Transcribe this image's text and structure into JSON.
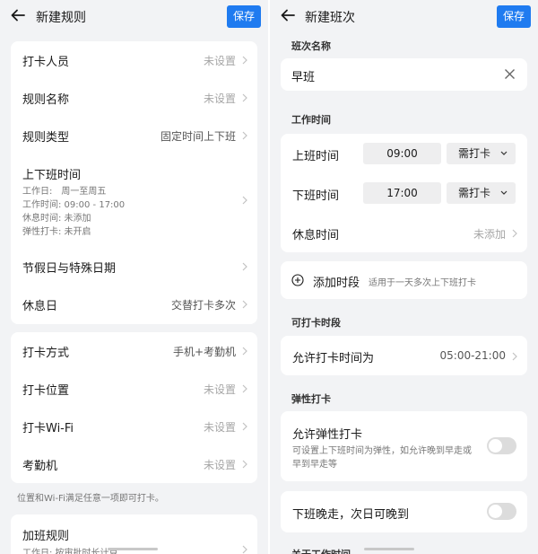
{
  "left": {
    "header": {
      "title": "新建规则",
      "save_label": "保存"
    },
    "card1": {
      "rows": [
        {
          "label": "打卡人员",
          "value": "未设置"
        },
        {
          "label": "规则名称",
          "value": "未设置"
        },
        {
          "label": "规则类型",
          "value": "固定时间上下班"
        }
      ],
      "schedule": {
        "title": "上下班时间",
        "lines": [
          "工作日:　周一至周五",
          "工作时间:  09:00 - 17:00",
          "休息时间:  未添加",
          "弹性打卡:  未开启"
        ]
      },
      "rows2": [
        {
          "label": "节假日与特殊日期",
          "value": ""
        },
        {
          "label": "休息日",
          "value": "交替打卡多次"
        }
      ]
    },
    "card2": {
      "rows": [
        {
          "label": "打卡方式",
          "value": "手机+考勤机"
        },
        {
          "label": "打卡位置",
          "value": "未设置"
        },
        {
          "label": "打卡Wi-Fi",
          "value": "未设置"
        },
        {
          "label": "考勤机",
          "value": "未设置"
        }
      ]
    },
    "note": "位置和Wi-Fi满足任意一项即可打卡。",
    "card3": {
      "title": "加班规则",
      "sub": "工作日:  按审批时长计算"
    }
  },
  "right": {
    "header": {
      "title": "新建班次",
      "save_label": "保存"
    },
    "name_section": "班次名称",
    "name_value": "早班",
    "work_section": "工作时间",
    "on_duty": {
      "label": "上班时间",
      "time": "09:00",
      "mode": "需打卡"
    },
    "off_duty": {
      "label": "下班时间",
      "time": "17:00",
      "mode": "需打卡"
    },
    "rest": {
      "label": "休息时间",
      "value": "未添加"
    },
    "add_period": {
      "label": "添加时段",
      "hint": "适用于一天多次上下班打卡"
    },
    "punch_section": "可打卡时段",
    "allow_punch": {
      "label": "允许打卡时间为",
      "value": "05:00-21:00"
    },
    "flex_section": "弹性打卡",
    "flex": {
      "label": "允许弹性打卡",
      "desc_line1": "可设置上下班时间为弹性，如允许晚到早走或",
      "desc_line2": "早到早走等"
    },
    "late_next": {
      "label": "下班晚走，次日可晚到"
    },
    "cut_section": "关于工作时间"
  }
}
